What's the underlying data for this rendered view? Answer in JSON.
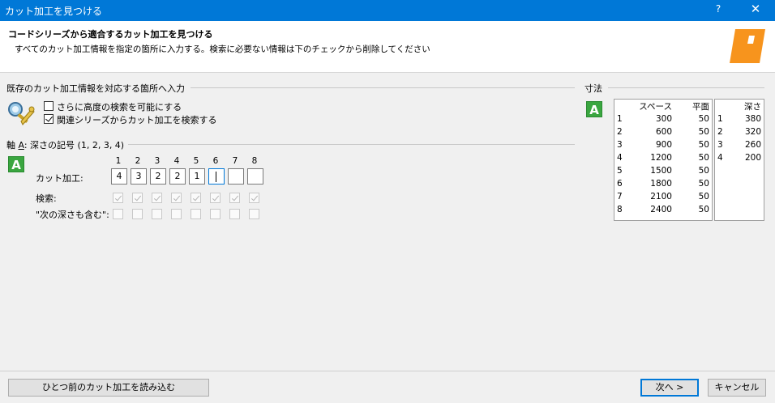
{
  "window": {
    "title": "カット加工を見つける",
    "help": "?",
    "close": "✕"
  },
  "header": {
    "title": "コードシリーズから適合するカット加工を見つける",
    "subtitle": "すべてのカット加工情報を指定の箇所に入力する。検索に必要ない情報は下のチェックから削除してください"
  },
  "input_section": {
    "label": "既存のカット加工情報を対応する箇所へ入力",
    "options": [
      {
        "label": "さらに高度の検索を可能にする",
        "checked": false
      },
      {
        "label": "関連シリーズからカット加工を検索する",
        "checked": true
      }
    ]
  },
  "axis": {
    "prefix": "軸 ",
    "letter": "A",
    "suffix": ": 深さの記号 (1, 2, 3, 4)",
    "badge": "A",
    "column_numbers": [
      "1",
      "2",
      "3",
      "4",
      "5",
      "6",
      "7",
      "8"
    ],
    "cut_label": "カット加工:",
    "cut_values": [
      "4",
      "3",
      "2",
      "2",
      "1",
      "",
      "",
      ""
    ],
    "search_label": "検索:",
    "search_checked": [
      true,
      true,
      true,
      true,
      true,
      true,
      true,
      true
    ],
    "include_label": "\"次の深さも含む\":",
    "include_checked": [
      false,
      false,
      false,
      false,
      false,
      false,
      false,
      false
    ]
  },
  "dimensions": {
    "label": "寸法",
    "badge": "A",
    "spacing_table": {
      "headers": [
        "",
        "スペース",
        "平面"
      ],
      "rows": [
        [
          "1",
          "300",
          "50"
        ],
        [
          "2",
          "600",
          "50"
        ],
        [
          "3",
          "900",
          "50"
        ],
        [
          "4",
          "1200",
          "50"
        ],
        [
          "5",
          "1500",
          "50"
        ],
        [
          "6",
          "1800",
          "50"
        ],
        [
          "7",
          "2100",
          "50"
        ],
        [
          "8",
          "2400",
          "50"
        ]
      ]
    },
    "depth_table": {
      "headers": [
        "",
        "深さ"
      ],
      "rows": [
        [
          "1",
          "380"
        ],
        [
          "2",
          "320"
        ],
        [
          "3",
          "260"
        ],
        [
          "4",
          "200"
        ]
      ]
    }
  },
  "footer": {
    "load_previous": "ひとつ前のカット加工を読み込む",
    "next": "次へ >",
    "cancel": "キャンセル"
  },
  "colors": {
    "titlebar": "#0078d7",
    "badge": "#3aa640",
    "logo": "#f7941d"
  }
}
